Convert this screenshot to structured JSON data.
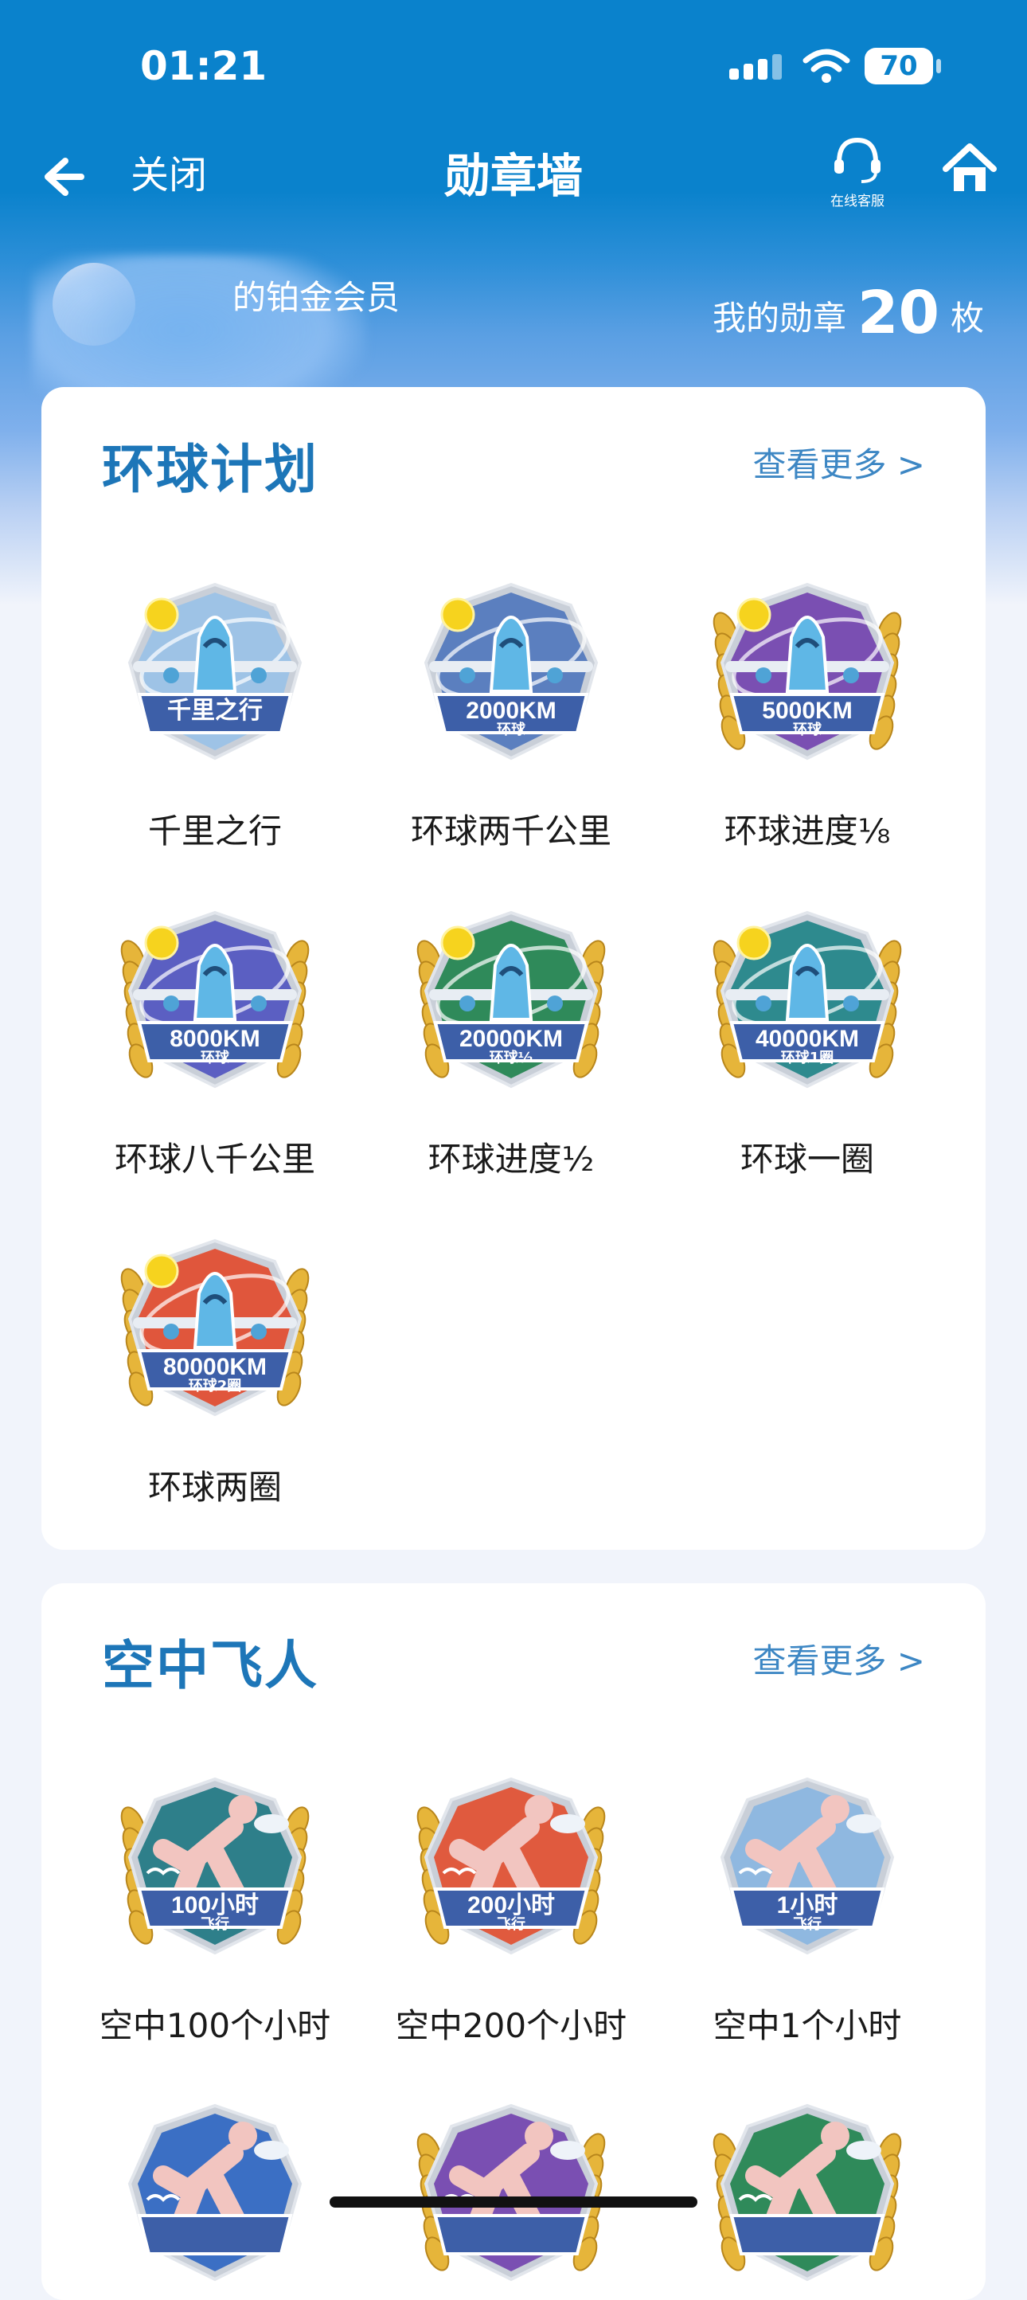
{
  "status_bar": {
    "time": "01:21",
    "battery": "70"
  },
  "nav": {
    "back_icon": "arrow-left-icon",
    "close_label": "关闭",
    "title": "勋章墙",
    "service_label": "在线客服",
    "home_icon": "home-icon"
  },
  "member": {
    "level_text": "的铂金会员",
    "badge_prefix": "我的勋章",
    "badge_count": "20",
    "badge_unit": "枚"
  },
  "sections": [
    {
      "title": "环球计划",
      "more": "查看更多 >",
      "badges": [
        {
          "name": "千里之行",
          "label": "千里之行",
          "sub": "",
          "color": "#9ec3e6",
          "gold": false
        },
        {
          "name": "环球两千公里",
          "label": "2000KM",
          "sub": "环球",
          "color": "#5b7fbf",
          "gold": false
        },
        {
          "name": "环球进度⅛",
          "label": "5000KM",
          "sub": "环球",
          "color": "#7a4fb2",
          "gold": true
        },
        {
          "name": "环球八千公里",
          "label": "8000KM",
          "sub": "环球",
          "color": "#5b5fc2",
          "gold": true
        },
        {
          "name": "环球进度½",
          "label": "20000KM",
          "sub": "环球½",
          "color": "#2f8a5a",
          "gold": true
        },
        {
          "name": "环球一圈",
          "label": "40000KM",
          "sub": "环球1圈",
          "color": "#2e8a8e",
          "gold": true
        },
        {
          "name": "环球两圈",
          "label": "80000KM",
          "sub": "环球2圈",
          "color": "#e0563c",
          "gold": true
        }
      ]
    },
    {
      "title": "空中飞人",
      "more": "查看更多 >",
      "badges": [
        {
          "name": "空中100个小时",
          "label": "100小时",
          "sub": "飞行",
          "color": "#2e7f8a",
          "gold": true
        },
        {
          "name": "空中200个小时",
          "label": "200小时",
          "sub": "飞行",
          "color": "#e05a3e",
          "gold": true
        },
        {
          "name": "空中1个小时",
          "label": "1小时",
          "sub": "飞行",
          "color": "#8fb8e0",
          "gold": false
        },
        {
          "name": "",
          "label": "",
          "sub": "",
          "color": "#3b6fc4",
          "gold": false
        },
        {
          "name": "",
          "label": "",
          "sub": "",
          "color": "#7a4fb2",
          "gold": true
        },
        {
          "name": "",
          "label": "",
          "sub": "",
          "color": "#2f8a5a",
          "gold": true
        }
      ]
    }
  ]
}
